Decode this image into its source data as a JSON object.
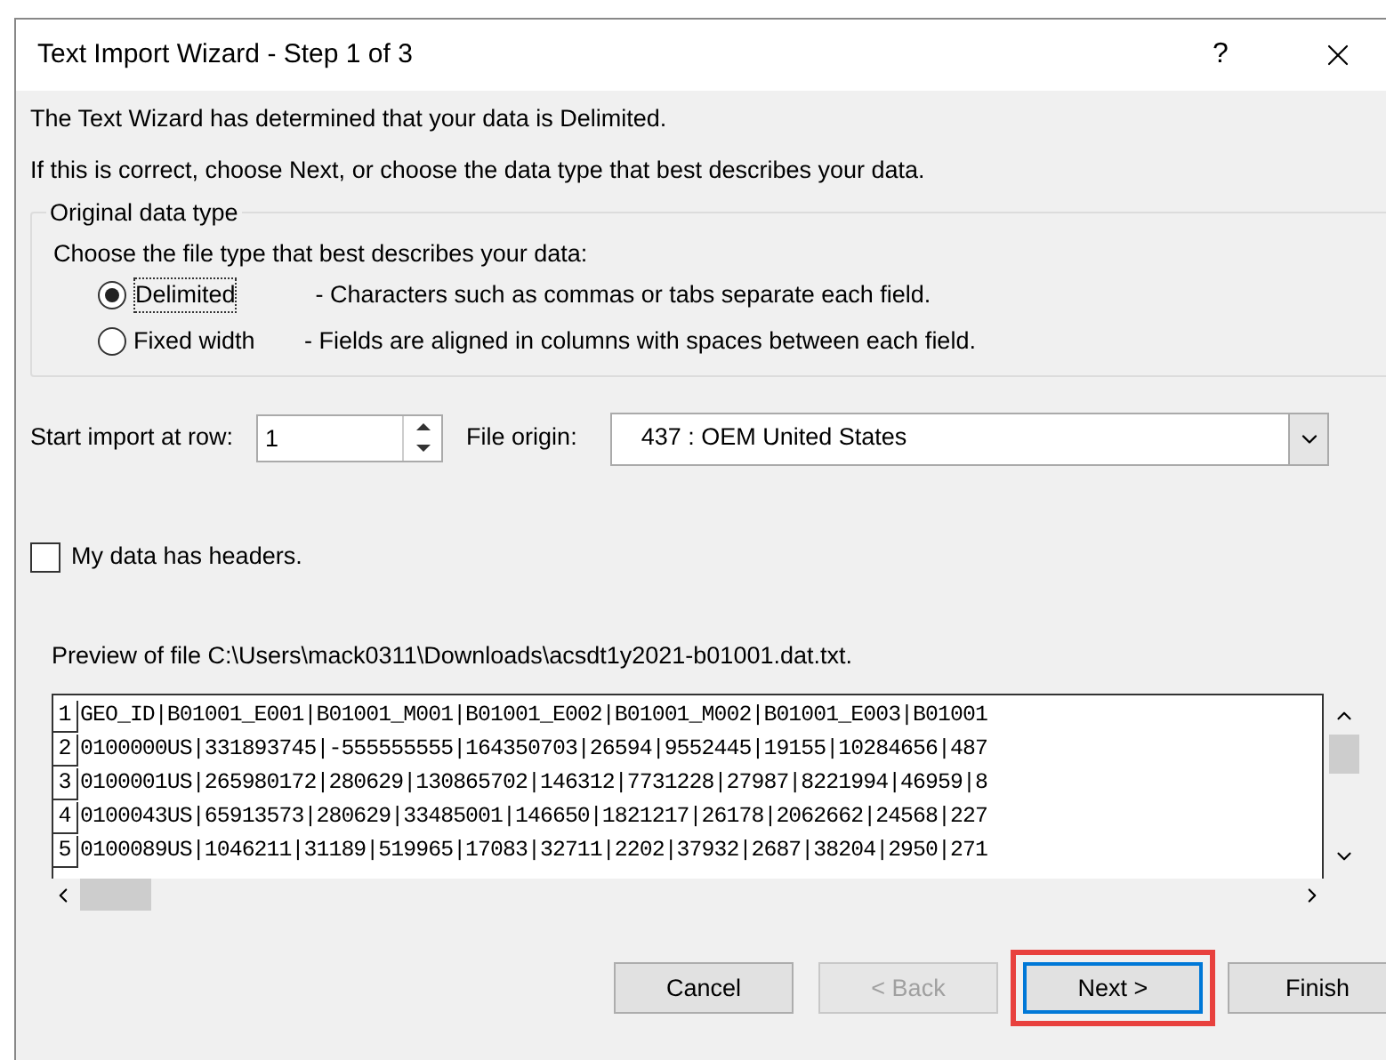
{
  "window": {
    "title": "Text Import Wizard - Step 1 of 3",
    "help": "?"
  },
  "intro": [
    "The Text Wizard has determined that your data is Delimited.",
    "If this is correct, choose Next, or choose the data type that best describes your data."
  ],
  "data_type": {
    "legend": "Original data type",
    "prompt": "Choose the file type that best describes your data:",
    "options": [
      {
        "label": "Delimited",
        "description": "- Characters such as commas or tabs separate each field.",
        "selected": true
      },
      {
        "label": "Fixed width",
        "description": "- Fields are aligned in columns with spaces between each field.",
        "selected": false
      }
    ]
  },
  "start_row": {
    "label": "Start import at row:",
    "value": "1"
  },
  "file_origin": {
    "label": "File origin:",
    "value": "437 : OEM United States"
  },
  "headers_checkbox": {
    "label": "My data has headers.",
    "checked": false
  },
  "preview": {
    "caption": "Preview of file C:\\Users\\mack0311\\Downloads\\acsdt1y2021-b01001.dat.txt.",
    "rows": [
      {
        "number": "1",
        "text": "GEO_ID|B01001_E001|B01001_M001|B01001_E002|B01001_M002|B01001_E003|B01001"
      },
      {
        "number": "2",
        "text": "0100000US|331893745|-555555555|164350703|26594|9552445|19155|10284656|487"
      },
      {
        "number": "3",
        "text": "0100001US|265980172|280629|130865702|146312|7731228|27987|8221994|46959|8"
      },
      {
        "number": "4",
        "text": "0100043US|65913573|280629|33485001|146650|1821217|26178|2062662|24568|227"
      },
      {
        "number": "5",
        "text": "0100089US|1046211|31189|519965|17083|32711|2202|37932|2687|38204|2950|271"
      }
    ]
  },
  "buttons": [
    {
      "label": "Cancel",
      "disabled": false,
      "default": false,
      "highlighted": false
    },
    {
      "label": "< Back",
      "disabled": true,
      "default": false,
      "highlighted": false
    },
    {
      "label": "Next >",
      "disabled": false,
      "default": true,
      "highlighted": true
    },
    {
      "label": "Finish",
      "disabled": false,
      "default": false,
      "highlighted": false
    }
  ]
}
